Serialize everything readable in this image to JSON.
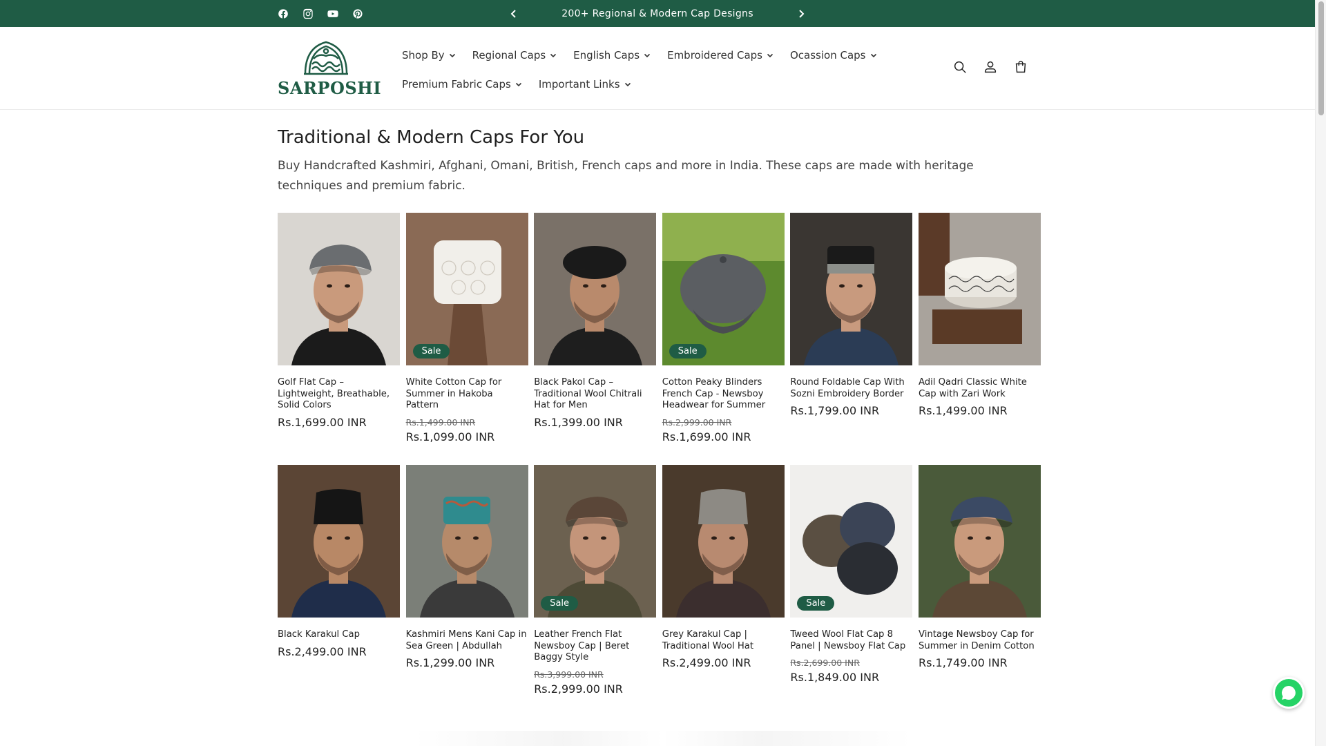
{
  "announcement": {
    "text": "200+ Regional & Modern Cap Designs",
    "social": [
      "facebook-icon",
      "instagram-icon",
      "youtube-icon",
      "pinterest-icon"
    ]
  },
  "brand": {
    "logo_text": "SARPOSHI",
    "accent_color": "#1f5c45"
  },
  "nav": {
    "row1": [
      "Shop By",
      "Regional Caps",
      "English Caps",
      "Embroidered Caps",
      "Ocassion Caps"
    ],
    "row2": [
      "Premium Fabric Caps",
      "Important Links"
    ]
  },
  "header_icons": [
    "search-icon",
    "account-icon",
    "cart-icon"
  ],
  "collection": {
    "title": "Traditional & Modern Caps For You",
    "description": "Buy Handcrafted Kashmiri, Afghani, Omani, British, French caps and more in India. These caps are made with heritage techniques and premium fabric."
  },
  "sale_label": "Sale",
  "products": [
    {
      "name": "Golf Flat Cap – Lightweight, Breathable, Solid Colors",
      "price": "Rs.1,699.00 INR",
      "old_price": "",
      "sale": false
    },
    {
      "name": "White Cotton Cap for Summer in Hakoba Pattern",
      "price": "Rs.1,099.00 INR",
      "old_price": "Rs.1,499.00 INR",
      "sale": true
    },
    {
      "name": "Black Pakol Cap – Traditional Wool Chitrali Hat for Men",
      "price": "Rs.1,399.00 INR",
      "old_price": "",
      "sale": false
    },
    {
      "name": "Cotton Peaky Blinders French Cap - Newsboy Headwear for Summer",
      "price": "Rs.1,699.00 INR",
      "old_price": "Rs.2,999.00 INR",
      "sale": true
    },
    {
      "name": "Round Foldable Cap With Sozni Embroidery Border",
      "price": "Rs.1,799.00 INR",
      "old_price": "",
      "sale": false
    },
    {
      "name": "Adil Qadri Classic White Cap with Zari Work",
      "price": "Rs.1,499.00 INR",
      "old_price": "",
      "sale": false
    },
    {
      "name": "Black Karakul Cap",
      "price": "Rs.2,499.00 INR",
      "old_price": "",
      "sale": false
    },
    {
      "name": "Kashmiri Mens Kani Cap in Sea Green | Abdullah",
      "price": "Rs.1,299.00 INR",
      "old_price": "",
      "sale": false
    },
    {
      "name": "Leather French Flat Newsboy Cap | Beret Baggy Style",
      "price": "Rs.2,999.00 INR",
      "old_price": "Rs.3,999.00 INR",
      "sale": true
    },
    {
      "name": "Grey Karakul Cap | Traditional Wool Hat",
      "price": "Rs.2,499.00 INR",
      "old_price": "",
      "sale": false
    },
    {
      "name": "Tweed Wool Flat Cap 8 Panel | Newsboy Flat Cap",
      "price": "Rs.1,849.00 INR",
      "old_price": "Rs.2,699.00 INR",
      "sale": true
    },
    {
      "name": "Vintage Newsboy Cap for Summer in Denim Cotton",
      "price": "Rs.1,749.00 INR",
      "old_price": "",
      "sale": false
    }
  ]
}
